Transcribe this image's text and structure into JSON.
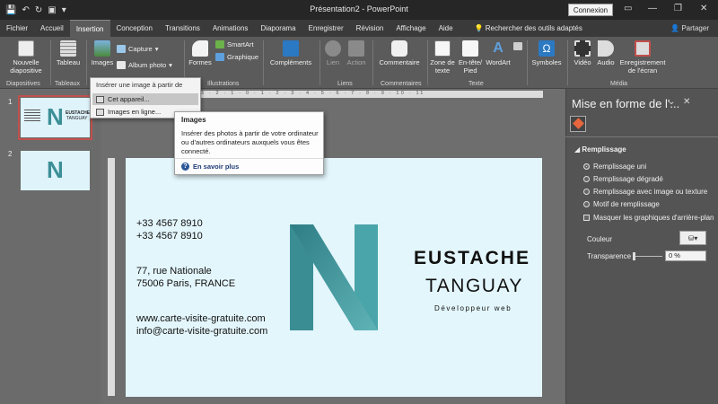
{
  "window": {
    "title": "Présentation2  -  PowerPoint",
    "signin_label": "Connexion"
  },
  "tabs": [
    {
      "label": "Fichier"
    },
    {
      "label": "Accueil"
    },
    {
      "label": "Insertion",
      "active": true
    },
    {
      "label": "Conception"
    },
    {
      "label": "Transitions"
    },
    {
      "label": "Animations"
    },
    {
      "label": "Diaporama"
    },
    {
      "label": "Enregistrer"
    },
    {
      "label": "Révision"
    },
    {
      "label": "Affichage"
    },
    {
      "label": "Aide"
    }
  ],
  "search_label": "Rechercher des outils adaptés",
  "share_label": "Partager",
  "ribbon": {
    "new_slide": "Nouvelle diapositive",
    "table": "Tableau",
    "images": "Images",
    "capture": "Capture",
    "photo_album": "Album photo",
    "shapes": "Formes",
    "smartart": "SmartArt",
    "chart": "Graphique",
    "addins": "Compléments",
    "link": "Lien",
    "action": "Action",
    "comment": "Commentaire",
    "textbox": "Zone de texte",
    "header_footer": "En-tête/ Pied",
    "wordart": "WordArt",
    "symbols": "Symboles",
    "video": "Vidéo",
    "audio": "Audio",
    "screen_recording": "Enregistrement de l'écran",
    "groups": {
      "slides": "Diapositives",
      "tables": "Tableaux",
      "illustrations": "Illustrations",
      "links": "Liens",
      "comments": "Commentaires",
      "text": "Texte",
      "media": "Média"
    }
  },
  "dropdown": {
    "header": "Insérer une image à partir de",
    "items": [
      "Cet appareil...",
      "Images en ligne..."
    ]
  },
  "tooltip": {
    "title": "Images",
    "body": "Insérer des photos à partir de votre ordinateur ou d'autres ordinateurs auxquels vous êtes connecté.",
    "link": "En savoir plus"
  },
  "slides": [
    {
      "number": "1",
      "selected": true
    },
    {
      "number": "2",
      "selected": false
    }
  ],
  "card": {
    "phone1": "+33 4567 8910",
    "phone2": "+33 4567 8910",
    "address1": "77, rue Nationale",
    "address2": "75006 Paris, FRANCE",
    "website": "www.carte-visite-gratuite.com",
    "email": "info@carte-visite-gratuite.com",
    "first_name": "EUSTACHE",
    "last_name": "TANGUAY",
    "role": "Développeur web",
    "logo_letter": "N",
    "logo_color": "#3e9aa0"
  },
  "format_pane": {
    "title": "Mise en forme de l'...",
    "section": "Remplissage",
    "options": [
      {
        "label": "Remplissage uni",
        "selected": true
      },
      {
        "label": "Remplissage dégradé",
        "selected": false
      },
      {
        "label": "Remplissage avec image ou texture",
        "selected": false
      },
      {
        "label": "Motif de remplissage",
        "selected": false
      }
    ],
    "hide_bg_label": "Masquer les graphiques d'arrière-plan",
    "color_label": "Couleur",
    "transparency_label": "Transparence",
    "transparency_value": "0 %"
  },
  "ruler_text": "8 · 7 · 6 · 5 · 4 · 3 · 2 · 1 · 0 · 1 · 2 · 3 · 4 · 5 · 6 · 7 · 8 · 9 · 10 · 11"
}
